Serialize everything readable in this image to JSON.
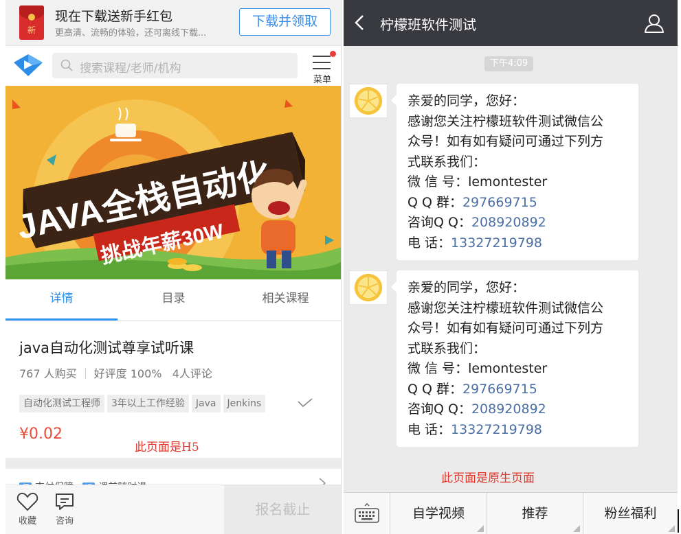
{
  "left": {
    "banner": {
      "icon_char": "新",
      "title": "现在下载送新手红包",
      "subtitle": "更高清、流畅的体验，还可离线下载...",
      "button": "下载并领取"
    },
    "search": {
      "placeholder": "搜索课程/老师/机构",
      "menu_label": "菜单"
    },
    "hero": {
      "headline": "JAVA全栈自动化",
      "subline": "挑战年薪30W"
    },
    "tabs": [
      "详情",
      "目录",
      "相关课程"
    ],
    "course": {
      "title": "java自动化测试尊享试听课",
      "buyers": "767 人购买",
      "rating": "好评度 100%",
      "reviews": "4人评论",
      "tags": [
        "自动化测试工程师",
        "3年以上工作经验",
        "Java",
        "Jenkins"
      ],
      "price": "¥0.02",
      "note": "此页面是H5"
    },
    "guarantee": {
      "icon1": "保",
      "text1": "支付保障",
      "icon2": "退",
      "text2": "课前随时退"
    },
    "bottom": {
      "favorite": "收藏",
      "consult": "咨询",
      "enroll": "报名截止"
    }
  },
  "right": {
    "title": "柠檬班软件测试",
    "time": "下午4:09",
    "messages": [
      {
        "greeting": "亲爱的同学，您好：",
        "line1": "感谢您关注柠檬班软件测试微信公",
        "line2": "众号！如有如有疑问可通过下列方",
        "line3": "式联系我们：",
        "wechat_label": "微 信 号：",
        "wechat": "lemontester",
        "qq_label": "Q Q 群：",
        "qq": "297669715",
        "consult_label": "咨询Q Q：",
        "consult": "208920892",
        "phone_label": "电 话：",
        "phone": "13327219798"
      },
      {
        "greeting": "亲爱的同学，您好：",
        "line1": "感谢您关注柠檬班软件测试微信公",
        "line2": "众号！如有如有疑问可通过下列方",
        "line3": "式联系我们：",
        "wechat_label": "微 信 号：",
        "wechat": "lemontester",
        "qq_label": "Q Q 群：",
        "qq": "297669715",
        "consult_label": "咨询Q Q：",
        "consult": "208920892",
        "phone_label": "电 话：",
        "phone": "13327219798"
      }
    ],
    "note": "此页面是原生页面",
    "menu": [
      "自学视频",
      "推荐",
      "粉丝福利"
    ]
  },
  "colors": {
    "accent_blue": "#2e8de6",
    "price_red": "#e94b3c",
    "note_red": "#e0372b",
    "wechat_bar": "#393a3f",
    "link_blue": "#4a6fa5"
  }
}
